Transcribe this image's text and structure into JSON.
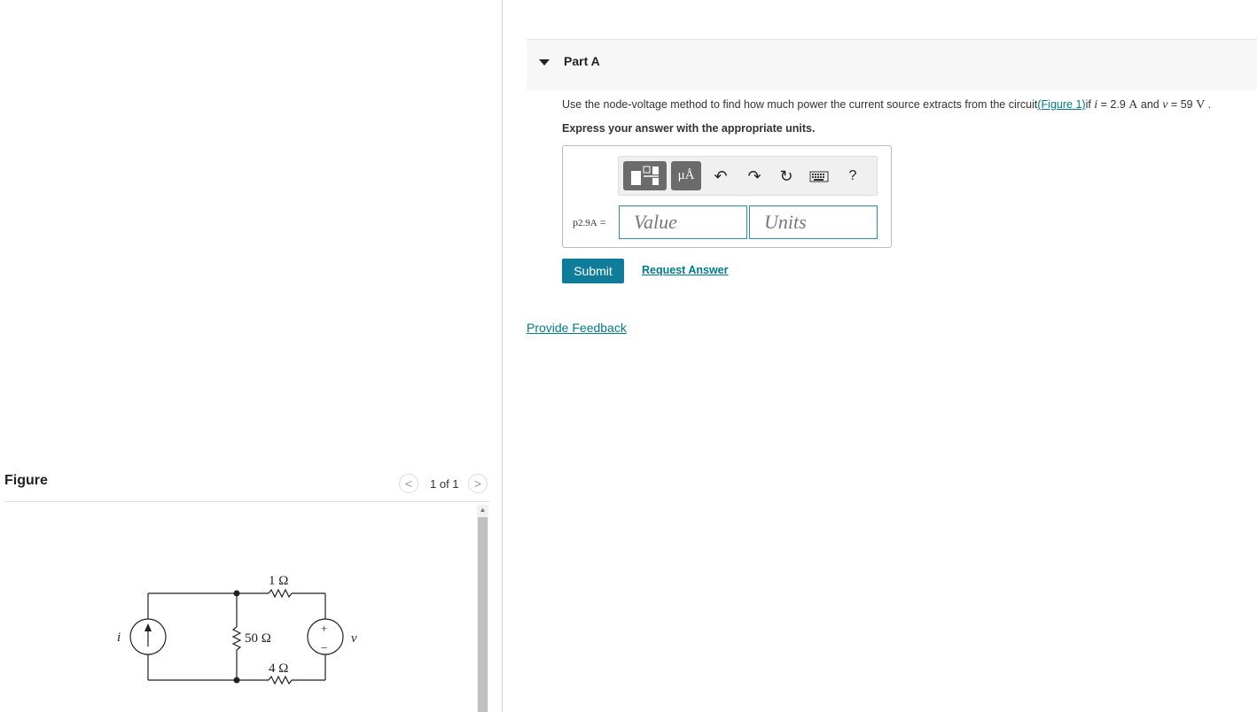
{
  "figure": {
    "title": "Figure",
    "pager_prev": "<",
    "pager_next": ">",
    "pager_count": "1 of 1",
    "circuit_labels": {
      "source_current": "i",
      "r_top": "1 Ω",
      "r_mid": "50 Ω",
      "r_bottom": "4 Ω",
      "source_voltage": "v",
      "plus": "+",
      "minus": "−"
    }
  },
  "part": {
    "title": "Part A",
    "question_pre": "Use the node-voltage method to find how much power the current source extracts from the circuit",
    "figure_link": "(Figure 1)",
    "question_if": "if ",
    "var_i": "i",
    "eq_i": " = 2.9 ",
    "unit_i": "A",
    "and_text": " and ",
    "var_v": "v",
    "eq_v": " = 59 ",
    "unit_v": "V",
    "tail": " .",
    "instruction": "Express your answer with the appropriate units."
  },
  "toolbar": {
    "units_label": "μÅ",
    "undo": "↶",
    "redo": "↷",
    "reset": "↻",
    "help": "?"
  },
  "answer": {
    "var_main": "p",
    "var_sub": "2.9A",
    "equals": " =",
    "value_placeholder": "Value",
    "units_placeholder": "Units"
  },
  "actions": {
    "submit": "Submit",
    "request_answer": "Request Answer",
    "feedback": "Provide Feedback"
  },
  "colors": {
    "accent": "#0f7d9a",
    "link": "#007c8a"
  }
}
